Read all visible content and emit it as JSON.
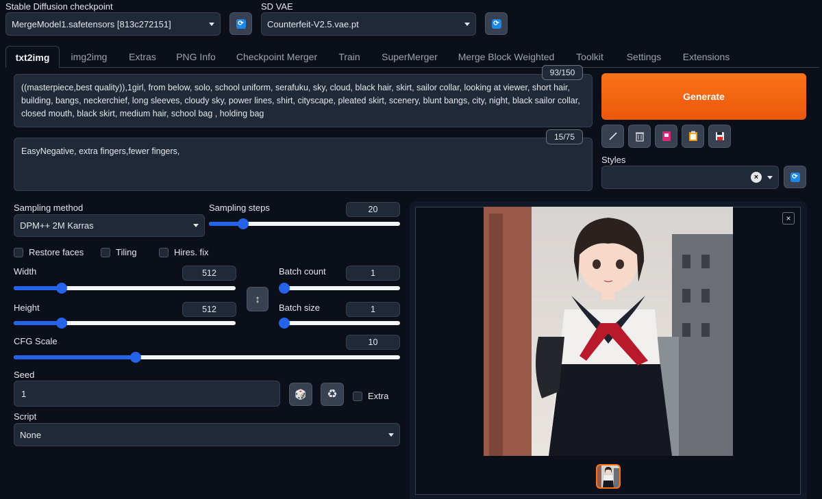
{
  "checkpoint": {
    "label": "Stable Diffusion checkpoint",
    "value": "MergeModel1.safetensors [813c272151]"
  },
  "vae": {
    "label": "SD VAE",
    "value": "Counterfeit-V2.5.vae.pt"
  },
  "tabs": [
    {
      "label": "txt2img",
      "active": true
    },
    {
      "label": "img2img"
    },
    {
      "label": "Extras"
    },
    {
      "label": "PNG Info"
    },
    {
      "label": "Checkpoint Merger"
    },
    {
      "label": "Train"
    },
    {
      "label": "SuperMerger"
    },
    {
      "label": "Merge Block Weighted"
    },
    {
      "label": "Toolkit"
    },
    {
      "label": "Settings"
    },
    {
      "label": "Extensions"
    }
  ],
  "prompt": {
    "text": "((masterpiece,best quality)),1girl, from below, solo, school uniform, serafuku, sky, cloud, black hair, skirt, sailor collar, looking at viewer, short hair, building, bangs, neckerchief, long sleeves, cloudy sky, power lines, shirt, cityscape, pleated skirt, scenery, blunt bangs, city, night, black sailor collar, closed mouth, black skirt, medium hair, school bag , holding bag",
    "token_count": "93/150"
  },
  "negative_prompt": {
    "text": "EasyNegative, extra fingers,fewer fingers,",
    "token_count": "15/75"
  },
  "generate_label": "Generate",
  "styles": {
    "label": "Styles",
    "value": ""
  },
  "sampling": {
    "method_label": "Sampling method",
    "method_value": "DPM++ 2M Karras",
    "steps_label": "Sampling steps",
    "steps_value": "20",
    "steps_fraction": 0.16
  },
  "checkboxes": {
    "restore_faces": "Restore faces",
    "tiling": "Tiling",
    "hires_fix": "Hires. fix"
  },
  "width": {
    "label": "Width",
    "value": "512",
    "fraction": 0.2
  },
  "height": {
    "label": "Height",
    "value": "512",
    "fraction": 0.2
  },
  "batch_count": {
    "label": "Batch count",
    "value": "1",
    "fraction": 0.0
  },
  "batch_size": {
    "label": "Batch size",
    "value": "1",
    "fraction": 0.0
  },
  "cfg": {
    "label": "CFG Scale",
    "value": "10",
    "fraction": 0.31
  },
  "seed": {
    "label": "Seed",
    "value": "1",
    "extra_label": "Extra"
  },
  "script": {
    "label": "Script",
    "value": "None"
  },
  "icons": {
    "swap": "↕",
    "dice": "🎲",
    "recycle": "♻"
  },
  "colors": {
    "accent": "#2563eb",
    "generate": "#f97316",
    "background": "#0b0f19"
  }
}
